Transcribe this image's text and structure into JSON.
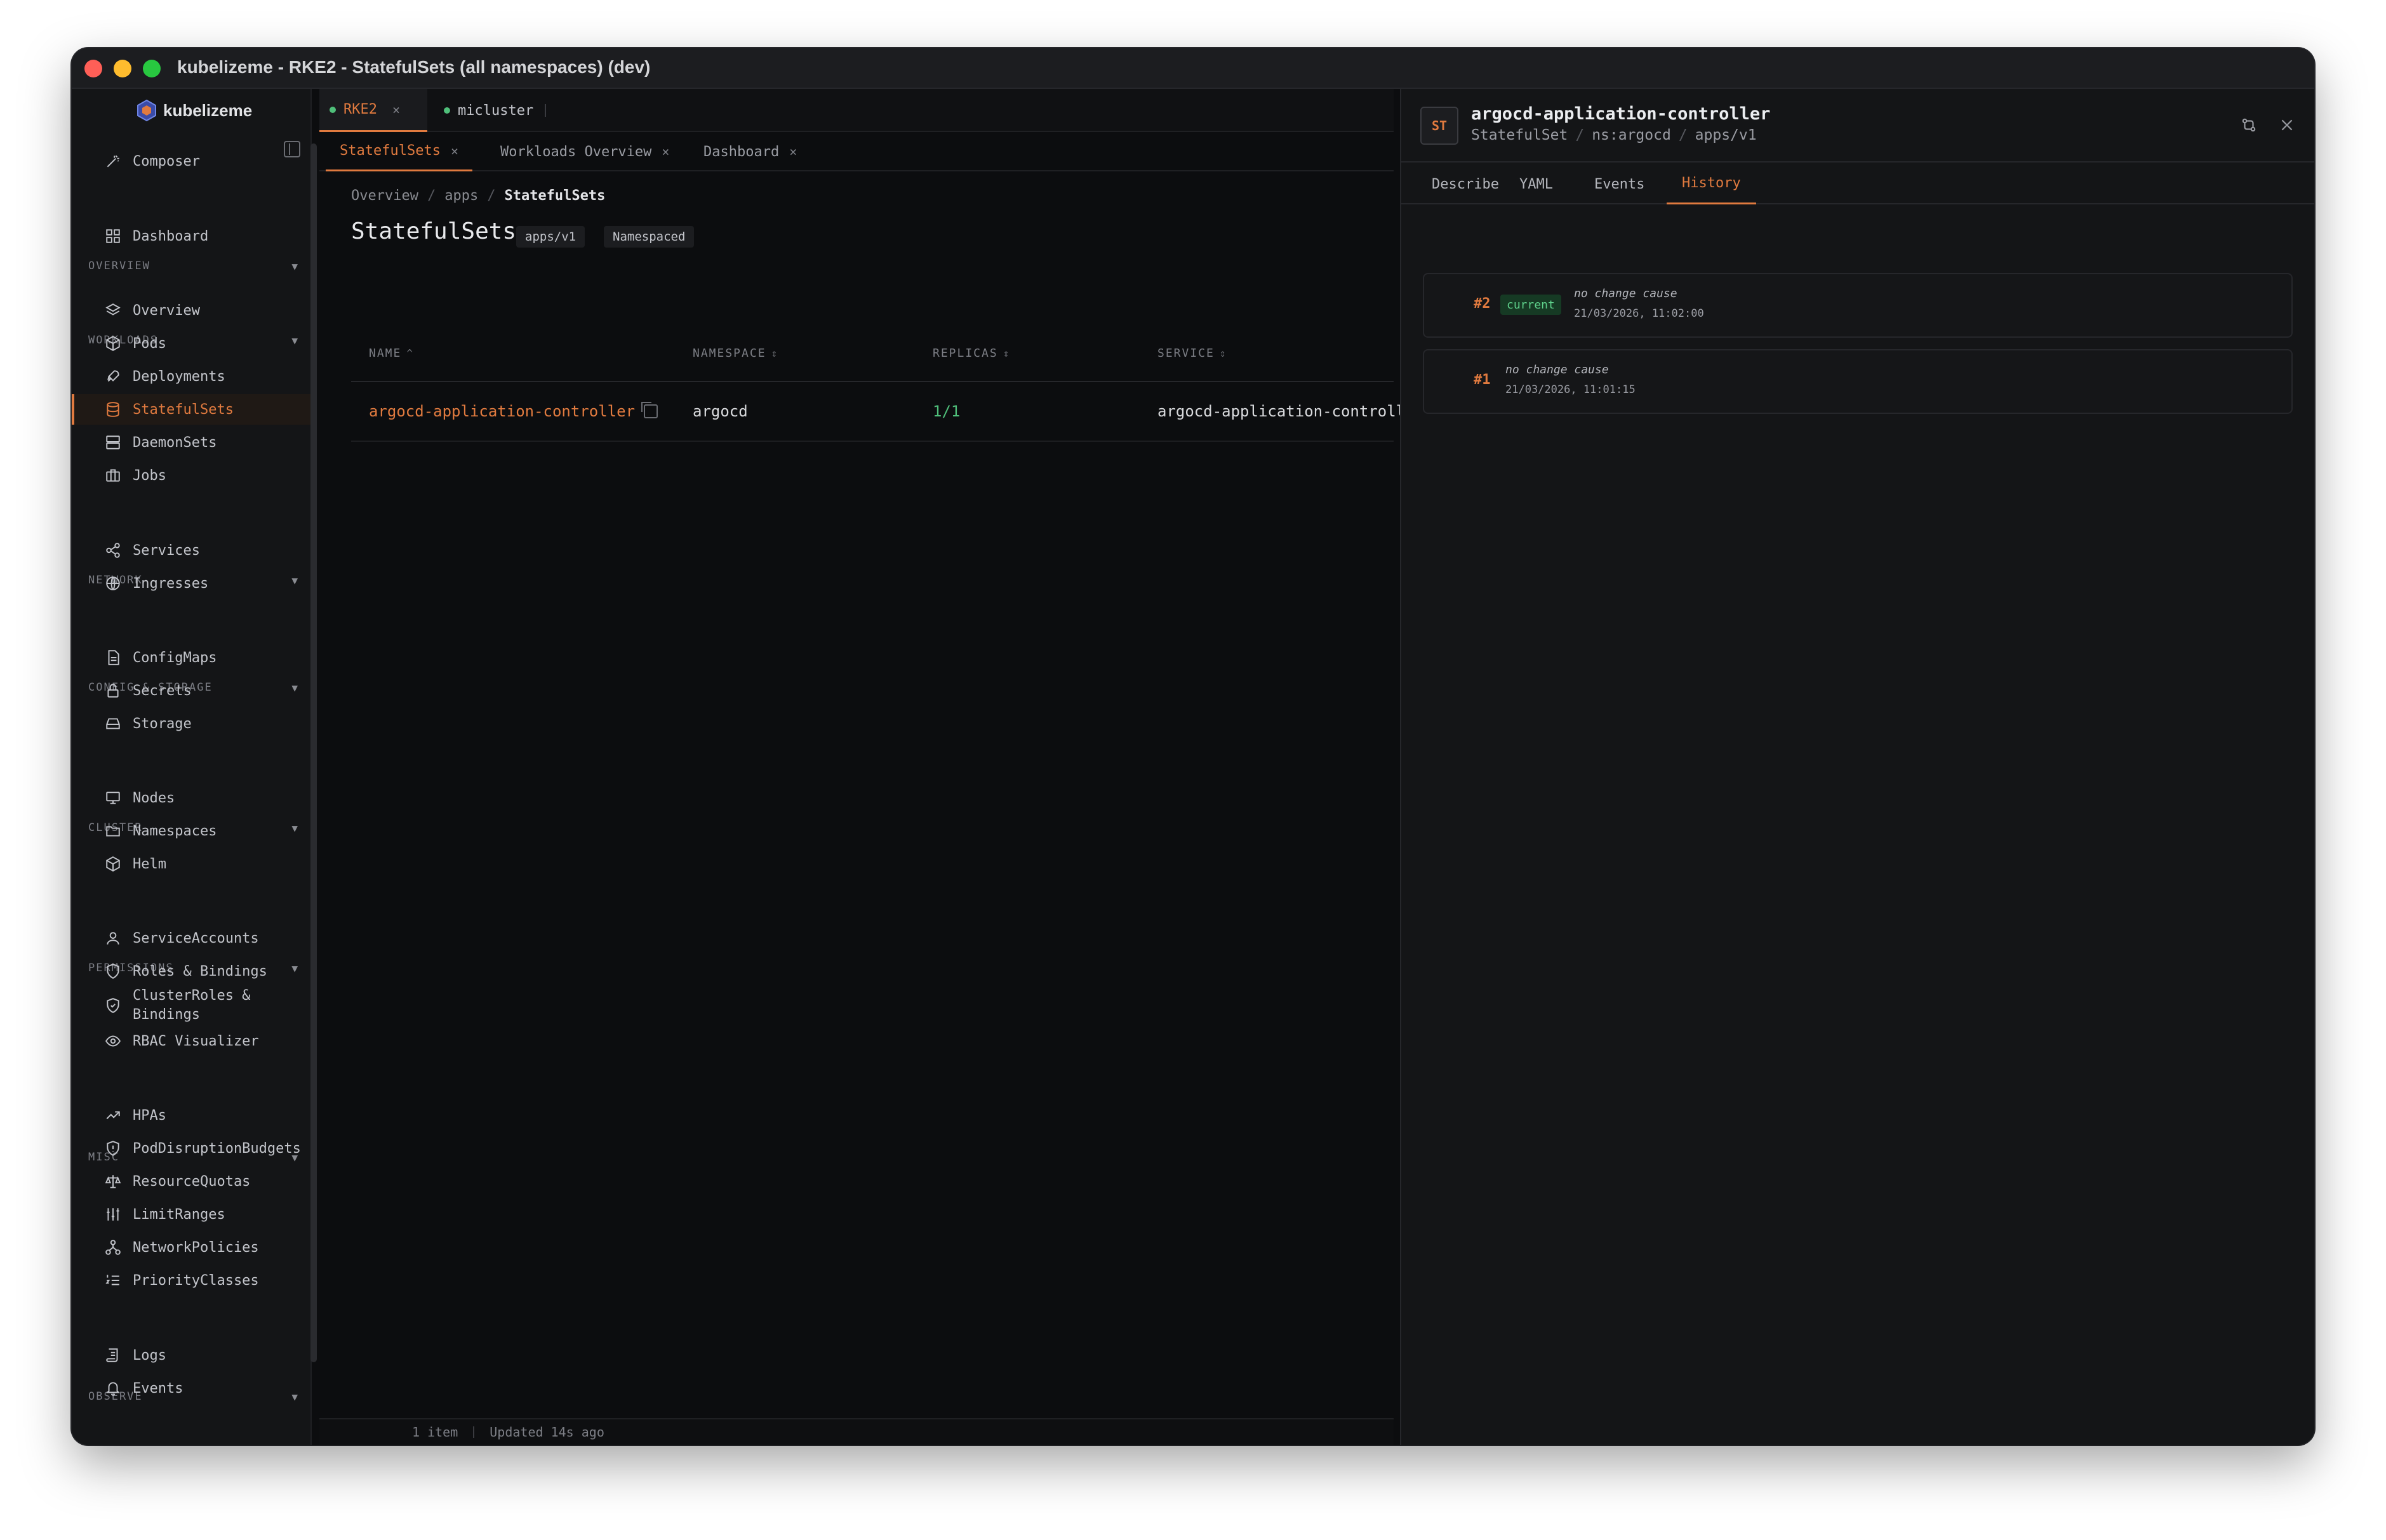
{
  "window": {
    "title": "kubelizeme - RKE2 - StatefulSets (all namespaces) (dev)"
  },
  "brand": {
    "name": "kubelizeme"
  },
  "sidebar": {
    "composer": "Composer",
    "sections": {
      "overview": "OVERVIEW",
      "workloads": "WORKLOADS",
      "network": "NETWORK",
      "config": "CONFIG & STORAGE",
      "cluster": "CLUSTER",
      "permissions": "PERMISSIONS",
      "misc": "MISC",
      "observe": "OBSERVE"
    },
    "caret": "▼",
    "items": {
      "dashboard": "Dashboard",
      "overview": "Overview",
      "pods": "Pods",
      "deployments": "Deployments",
      "statefulsets": "StatefulSets",
      "daemonsets": "DaemonSets",
      "jobs": "Jobs",
      "services": "Services",
      "ingresses": "Ingresses",
      "configmaps": "ConfigMaps",
      "secrets": "Secrets",
      "storage": "Storage",
      "nodes": "Nodes",
      "namespaces": "Namespaces",
      "helm": "Helm",
      "serviceaccounts": "ServiceAccounts",
      "roles": "Roles & Bindings",
      "clusterroles_1": "ClusterRoles &",
      "clusterroles_2": "Bindings",
      "rbac": "RBAC Visualizer",
      "hpas": "HPAs",
      "pdbs": "PodDisruptionBudgets",
      "quotas": "ResourceQuotas",
      "limits": "LimitRanges",
      "netpol": "NetworkPolicies",
      "priority": "PriorityClasses",
      "logs": "Logs",
      "events": "Events"
    }
  },
  "connections": {
    "tabs": [
      {
        "label": "RKE2",
        "close": "×"
      },
      {
        "label": "micluster"
      }
    ]
  },
  "view_tabs": [
    {
      "label": "StatefulSets",
      "close": "×"
    },
    {
      "label": "Workloads Overview",
      "close": "×"
    },
    {
      "label": "Dashboard",
      "close": "×"
    }
  ],
  "breadcrumb": {
    "a": "Overview",
    "b": "apps",
    "c": "StatefulSets",
    "sep": "/"
  },
  "page": {
    "title": "StatefulSets",
    "api": "apps/v1",
    "scope": "Namespaced"
  },
  "table": {
    "columns": {
      "name": "NAME",
      "namespace": "NAMESPACE",
      "replicas": "REPLICAS",
      "service": "SERVICE"
    },
    "sort_up": "^",
    "sort_both": "⇕",
    "rows": [
      {
        "name": "argocd-application-controller",
        "namespace": "argocd",
        "replicas": "1/1",
        "service": "argocd-application-controll"
      }
    ]
  },
  "status": {
    "count": "1 item",
    "updated": "Updated 14s ago"
  },
  "panel": {
    "badge": "ST",
    "title": "argocd-application-controller",
    "kind": "StatefulSet",
    "ns": "ns:argocd",
    "api": "apps/v1",
    "sep": "/",
    "tabs": {
      "describe": "Describe",
      "yaml": "YAML",
      "events": "Events",
      "history": "History"
    },
    "revisions": [
      {
        "num": "#2",
        "tag": "current",
        "cause": "no change cause",
        "time": "21/03/2026, 11:02:00"
      },
      {
        "num": "#1",
        "cause": "no change cause",
        "time": "21/03/2026, 11:01:15"
      }
    ]
  },
  "colors": {
    "accent": "#e07a3f",
    "ok": "#4fbf7a",
    "bg": "#0c0d0f"
  }
}
